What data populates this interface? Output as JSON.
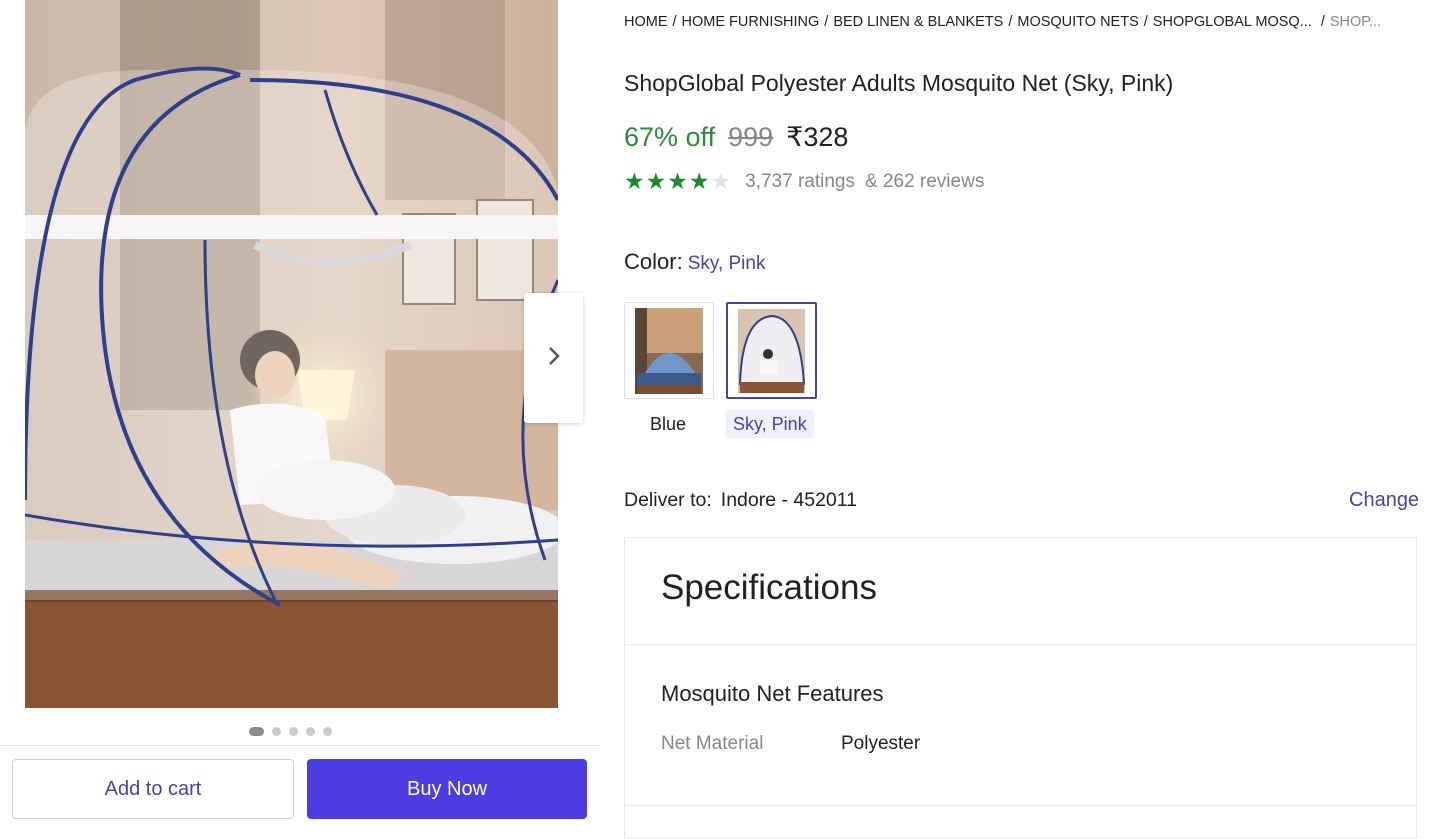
{
  "breadcrumbs": [
    "HOME",
    "HOME FURNISHING",
    "BED LINEN & BLANKETS",
    "MOSQUITO NETS",
    "SHOPGLOBAL MOSQ...",
    "SHOP..."
  ],
  "product": {
    "title": "ShopGlobal Polyester Adults Mosquito Net (Sky, Pink)",
    "discount": "67% off",
    "mrp": "999",
    "price": "₹328",
    "rating_value": 4,
    "rating_max": 5,
    "ratings_text": "3,737 ratings",
    "reviews_text": "& 262 reviews"
  },
  "color": {
    "label": "Color:",
    "selected": "Sky, Pink",
    "options": [
      {
        "name": "Blue",
        "selected": false
      },
      {
        "name": "Sky, Pink",
        "selected": true
      }
    ]
  },
  "delivery": {
    "label": "Deliver to:",
    "location": "Indore - 452011",
    "change_label": "Change"
  },
  "specifications": {
    "heading": "Specifications",
    "group_title": "Mosquito Net Features",
    "rows": [
      {
        "key": "Net Material",
        "value": "Polyester"
      }
    ]
  },
  "gallery": {
    "dot_count": 5,
    "active_dot": 0
  },
  "actions": {
    "add_to_cart": "Add to cart",
    "buy_now": "Buy Now"
  },
  "colors": {
    "accent": "#4a42a8",
    "buy_button": "#4b3de3",
    "discount": "#2e8b3a",
    "star": "#1e8a2c"
  },
  "icons": [
    "chevron-right-icon",
    "star-icon"
  ]
}
